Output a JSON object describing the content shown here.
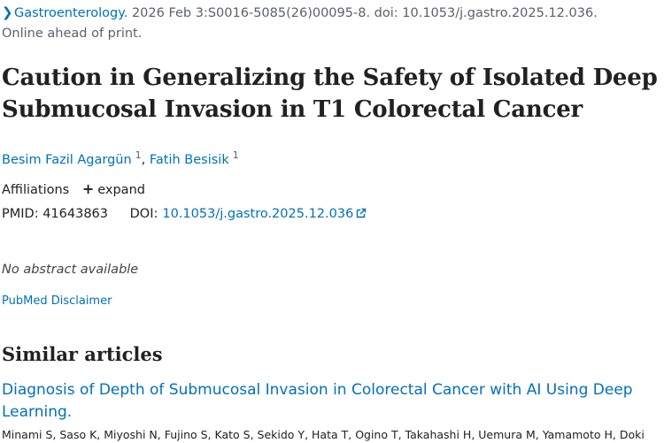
{
  "citation": {
    "journal": "Gastroenterology.",
    "details": "2026 Feb 3:S0016-5085(26)00095-8. doi: 10.1053/j.gastro.2025.12.036.",
    "status": "Online ahead of print."
  },
  "article": {
    "title": "Caution in Generalizing the Safety of Isolated Deep Submucosal Invasion in T1 Colorectal Cancer",
    "authors": [
      {
        "name": "Besim Fazil Agargün",
        "affiliation": "1"
      },
      {
        "name": "Fatih Besisik",
        "affiliation": "1"
      }
    ],
    "author_separator": ","
  },
  "affiliations": {
    "label": "Affiliations",
    "expand_label": "expand"
  },
  "identifiers": {
    "pmid_label": "PMID:",
    "pmid": "41643863",
    "doi_label": "DOI:",
    "doi": "10.1053/j.gastro.2025.12.036"
  },
  "abstract": {
    "text": "No abstract available"
  },
  "disclaimer": {
    "label": "PubMed Disclaimer"
  },
  "similar": {
    "heading": "Similar articles",
    "items": [
      {
        "title": "Diagnosis of Depth of Submucosal Invasion in Colorectal Cancer with AI Using Deep Learning.",
        "authors": "Minami S, Saso K, Miyoshi N, Fujino S, Kato S, Sekido Y, Hata T, Ogino T, Takahashi H, Uemura M, Yamamoto H, Doki"
      }
    ]
  },
  "colors": {
    "link": "#0071bc",
    "text": "#212121",
    "muted": "#5b616b"
  },
  "icons": {
    "journal_chevron": "chevron-right-icon",
    "expand": "plus-icon",
    "external_link": "external-link-icon"
  }
}
